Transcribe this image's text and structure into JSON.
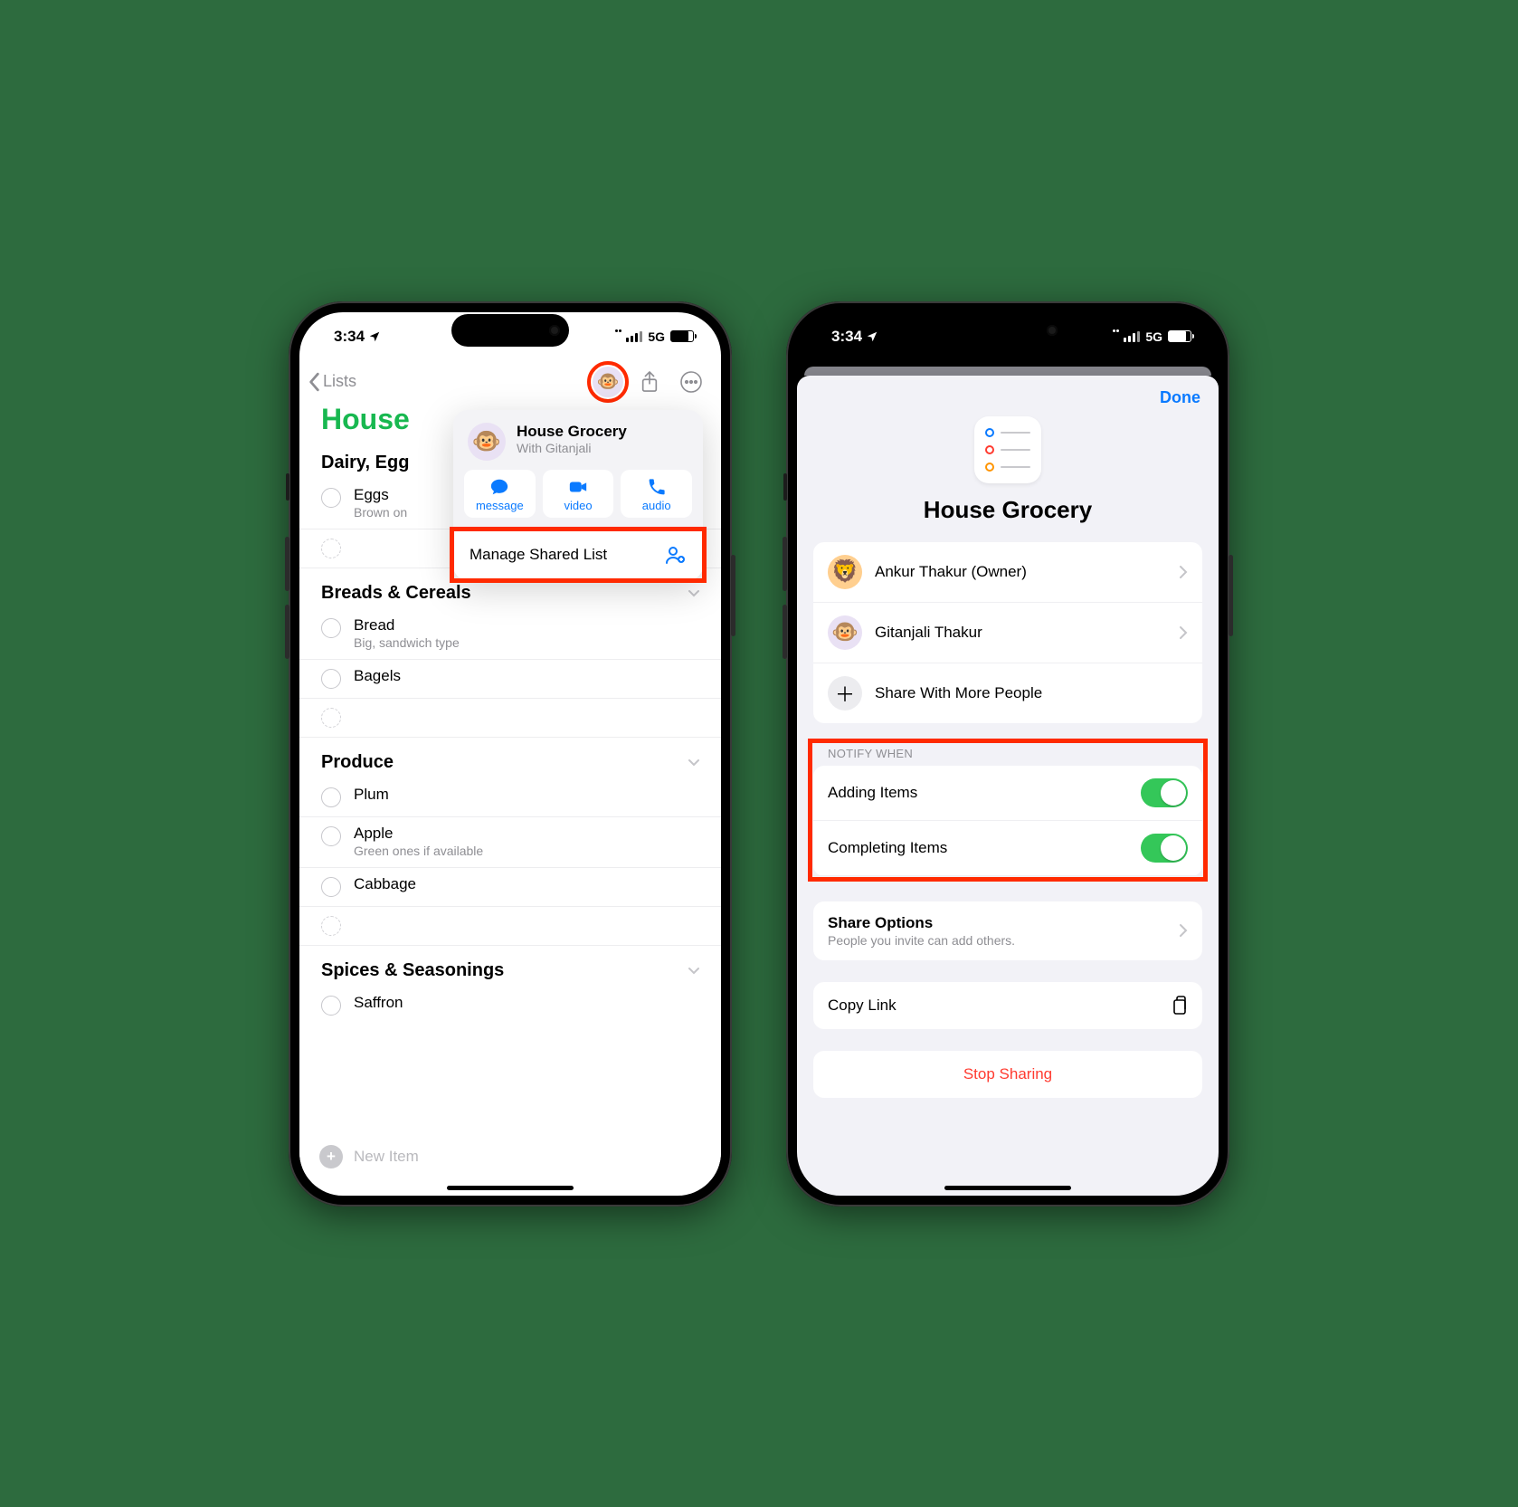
{
  "status": {
    "time": "3:34",
    "network": "5G"
  },
  "left": {
    "back_label": "Lists",
    "title": "House",
    "sections": [
      {
        "name": "Dairy, Egg",
        "items": [
          {
            "title": "Eggs",
            "sub": "Brown on"
          }
        ]
      },
      {
        "name": "Breads & Cereals",
        "items": [
          {
            "title": "Bread",
            "sub": "Big, sandwich type"
          },
          {
            "title": "Bagels",
            "sub": ""
          }
        ]
      },
      {
        "name": "Produce",
        "items": [
          {
            "title": "Plum",
            "sub": ""
          },
          {
            "title": "Apple",
            "sub": "Green ones if available"
          },
          {
            "title": "Cabbage",
            "sub": ""
          }
        ]
      },
      {
        "name": "Spices & Seasonings",
        "items": [
          {
            "title": "Saffron",
            "sub": ""
          }
        ]
      }
    ],
    "new_item": "New Item",
    "popover": {
      "title": "House Grocery",
      "subtitle": "With Gitanjali",
      "actions": {
        "message": "message",
        "video": "video",
        "audio": "audio"
      },
      "manage": "Manage Shared List"
    }
  },
  "right": {
    "done": "Done",
    "title": "House Grocery",
    "people": [
      {
        "name": "Ankur Thakur (Owner)",
        "kind": "orange"
      },
      {
        "name": "Gitanjali Thakur",
        "kind": "purple"
      }
    ],
    "share_more": "Share With More People",
    "notify_header": "Notify When",
    "notify": {
      "adding": "Adding Items",
      "completing": "Completing Items"
    },
    "share_options": {
      "title": "Share Options",
      "sub": "People you invite can add others."
    },
    "copy_link": "Copy Link",
    "stop": "Stop Sharing"
  }
}
